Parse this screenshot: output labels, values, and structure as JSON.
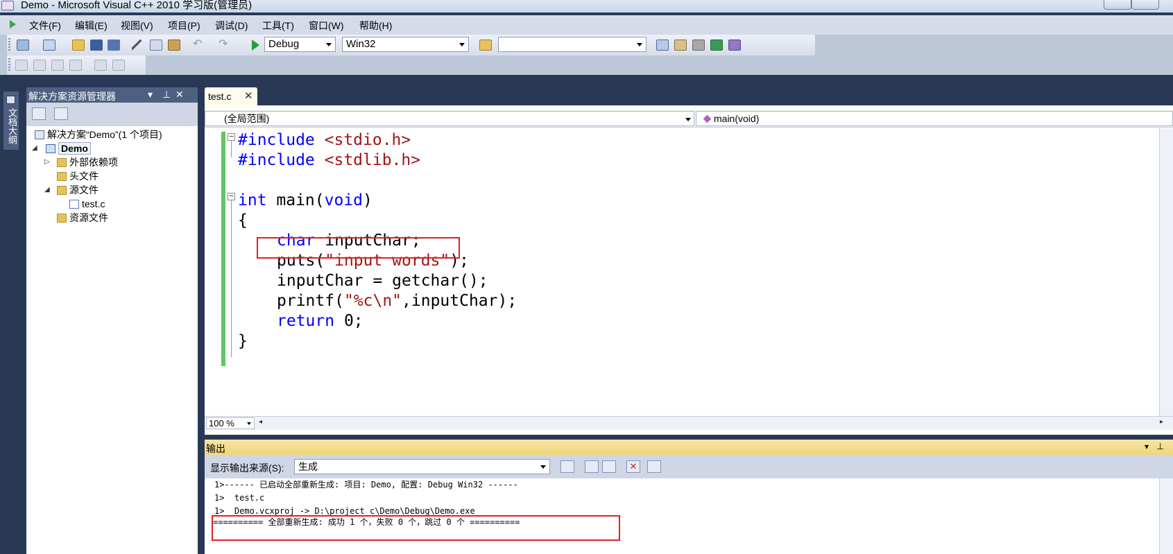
{
  "window": {
    "title": "Demo - Microsoft Visual C++ 2010 学习版(管理员)"
  },
  "menu": {
    "items": [
      "文件(F)",
      "编辑(E)",
      "视图(V)",
      "项目(P)",
      "调试(D)",
      "工具(T)",
      "窗口(W)",
      "帮助(H)"
    ]
  },
  "toolbar": {
    "configuration": "Debug",
    "platform": "Win32",
    "find_value": ""
  },
  "side_tab": {
    "label": "文档大纲"
  },
  "solution_explorer": {
    "title": "解决方案资源管理器",
    "tree": {
      "solution": "解决方案“Demo”(1 个项目)",
      "project": "Demo",
      "external_deps": "外部依赖项",
      "header_files": "头文件",
      "source_files": "源文件",
      "source_file": "test.c",
      "resource_files": "资源文件"
    }
  },
  "editor": {
    "tab_label": "test.c",
    "scope": "(全局范围)",
    "member": "main(void)",
    "zoom": "100 %",
    "code": {
      "l1_a": "#include ",
      "l1_b": "<stdio.h>",
      "l2_a": "#include ",
      "l2_b": "<stdlib.h>",
      "l4_kw1": "int",
      "l4_mid": " main(",
      "l4_kw2": "void",
      "l4_end": ")",
      "l5": "{",
      "l6_kw": "char",
      "l6_rest": " inputChar;",
      "l7_a": "puts(",
      "l7_str": "\"input words\"",
      "l7_end": ");",
      "l8": "inputChar = getchar();",
      "l9_a": "printf(",
      "l9_str": "\"%c\\n\"",
      "l9_end": ",inputChar);",
      "l10_kw": "return",
      "l10_rest": " 0;",
      "l11": "}"
    }
  },
  "output": {
    "title": "输出",
    "source_label": "显示输出来源(S):",
    "source_value": "生成",
    "lines": [
      "1>------ 已启动全部重新生成: 项目: Demo, 配置: Debug Win32 ------",
      "1>  test.c",
      "1>  Demo.vcxproj -> D:\\project_c\\Demo\\Debug\\Demo.exe",
      "========== 全部重新生成: 成功 1 个，失败 0 个，跳过 0 个 =========="
    ]
  },
  "colors": {
    "keyword": "#0000ff",
    "string": "#a31515",
    "highlight_box": "#e02020",
    "ide_frame": "#293955"
  }
}
